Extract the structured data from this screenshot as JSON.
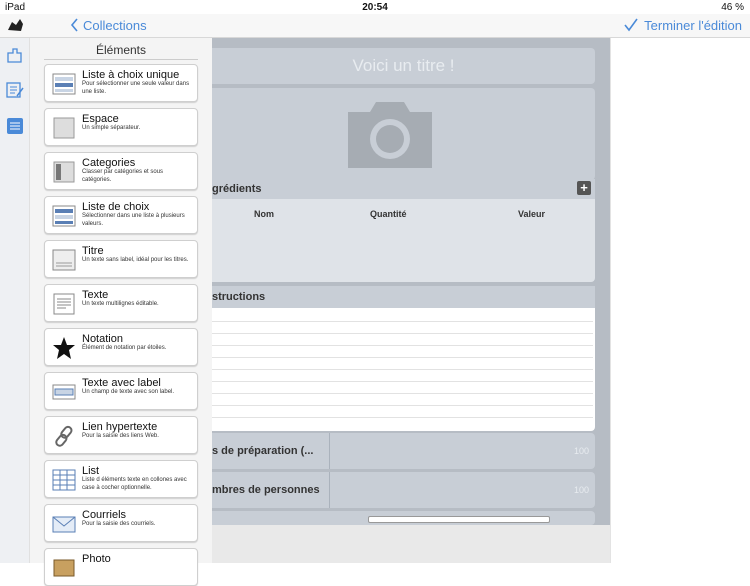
{
  "status": {
    "device": "iPad",
    "time": "20:54",
    "battery": "46 %"
  },
  "nav": {
    "back_label": "Collections",
    "done_label": "Terminer l'édition"
  },
  "panel": {
    "title": "Éléments",
    "items": [
      {
        "title": "Liste à choix unique",
        "desc": "Pour sélectionner une seule valeur dans une liste."
      },
      {
        "title": "Espace",
        "desc": "Un simple séparateur."
      },
      {
        "title": "Categories",
        "desc": "Classer par catégories et sous catégories."
      },
      {
        "title": "Liste de choix",
        "desc": "Sélectionner dans une liste à plusieurs valeurs."
      },
      {
        "title": "Titre",
        "desc": "Un texte sans label, idéal pour les titres."
      },
      {
        "title": "Texte",
        "desc": "Un texte multilignes éditable."
      },
      {
        "title": "Notation",
        "desc": "Élément de notation par étoiles."
      },
      {
        "title": "Texte avec label",
        "desc": "Un champ de texte avec son label."
      },
      {
        "title": "Lien hypertexte",
        "desc": "Pour la saisie des liens Web."
      },
      {
        "title": "List",
        "desc": "Liste d éléments texte en collones avec case à cocher optionnelle."
      },
      {
        "title": "Courriels",
        "desc": "Pour la saisie des courriels."
      },
      {
        "title": "Photo",
        "desc": ""
      }
    ]
  },
  "editor": {
    "title_placeholder": "Voici un titre !",
    "ingredients_header": "grédients",
    "columns": [
      "Nom",
      "Quantité",
      "Valeur"
    ],
    "instructions_header": "structions",
    "field1_label": "s de préparation (...",
    "field1_value": "100",
    "field2_label": "mbres de personnes",
    "field2_value": "100"
  }
}
